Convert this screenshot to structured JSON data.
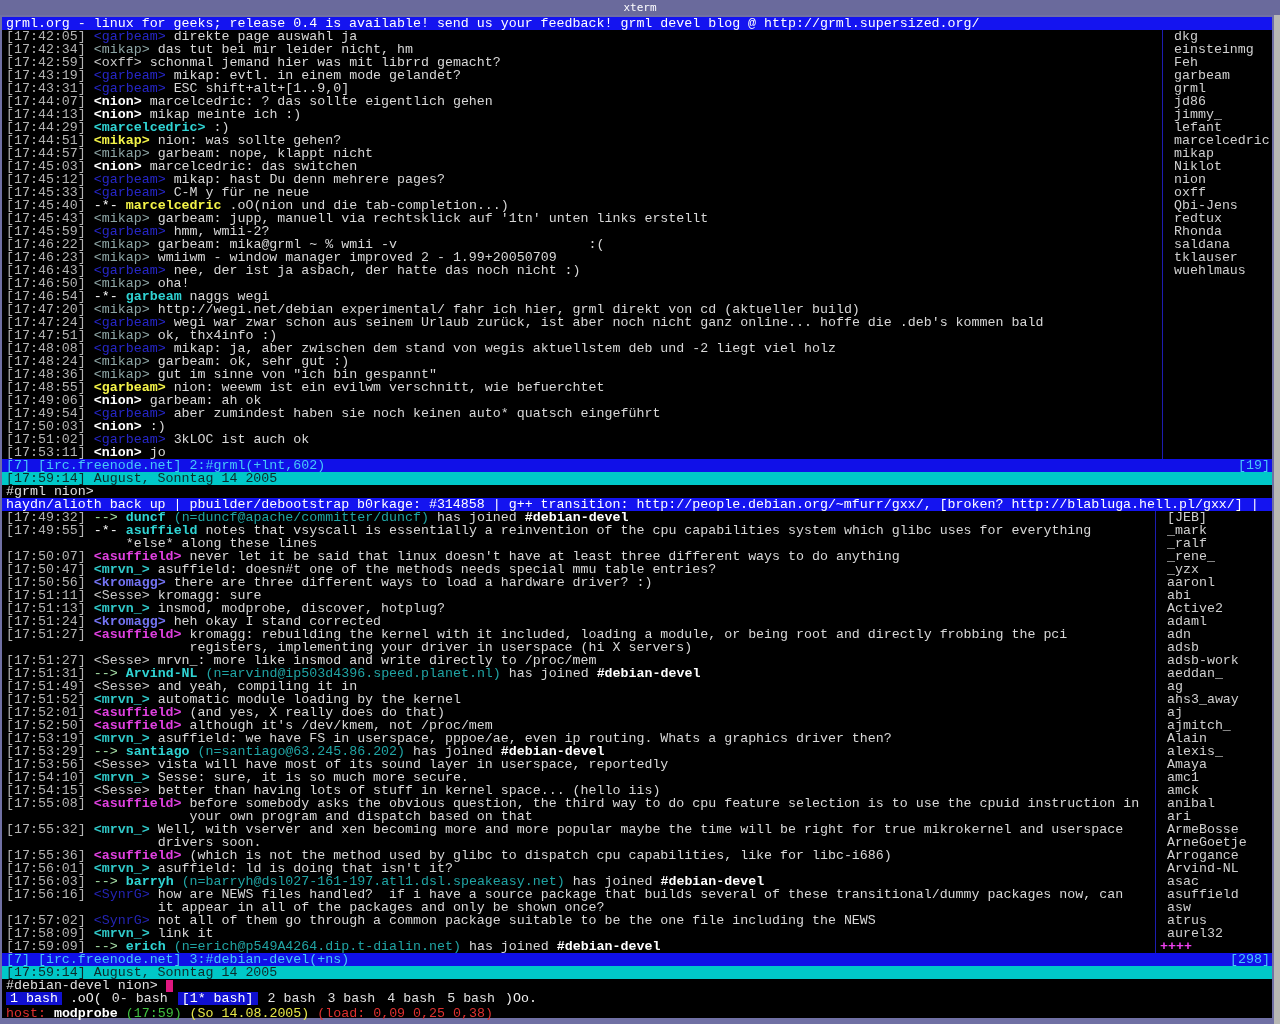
{
  "window": {
    "title": "xterm"
  },
  "panes": [
    {
      "topic": "grml.org - linux for geeks; release 0.4 is available! send us your feedback! grml devel blog @ http://grml.supersized.org/",
      "messages": [
        {
          "kind": "msg",
          "time": "[17:42:05]",
          "nick": "<garbeam>",
          "color": "#2626c8",
          "bold": false,
          "lines": [
            "direkte page auswahl ja"
          ]
        },
        {
          "kind": "msg",
          "time": "[17:42:34]",
          "nick": "<mikap>",
          "color": "#8ea6a6",
          "bold": false,
          "lines": [
            "das tut bei mir leider nicht, hm"
          ]
        },
        {
          "kind": "msg",
          "time": "[17:42:59]",
          "nick": "<oxff>",
          "color": "#c8c8c8",
          "bold": false,
          "lines": [
            "schonmal jemand hier was mit librrd gemacht?"
          ]
        },
        {
          "kind": "msg",
          "time": "[17:43:19]",
          "nick": "<garbeam>",
          "color": "#2626c8",
          "bold": false,
          "lines": [
            "mikap: evtl. in einem mode gelandet?"
          ]
        },
        {
          "kind": "msg",
          "time": "[17:43:31]",
          "nick": "<garbeam>",
          "color": "#2626c8",
          "bold": false,
          "lines": [
            "ESC shift+alt+[1..9,0]"
          ]
        },
        {
          "kind": "msg",
          "time": "[17:44:07]",
          "nick": "<nion>",
          "color": "#ffffff",
          "bold": true,
          "lines": [
            "marcelcedric: ? das sollte eigentlich gehen"
          ]
        },
        {
          "kind": "msg",
          "time": "[17:44:13]",
          "nick": "<nion>",
          "color": "#ffffff",
          "bold": true,
          "lines": [
            "mikap meinte ich :)"
          ]
        },
        {
          "kind": "msg",
          "time": "[17:44:29]",
          "nick": "<marcelcedric>",
          "color": "#30d4d4",
          "bold": true,
          "lines": [
            ":)"
          ]
        },
        {
          "kind": "msg",
          "time": "[17:44:51]",
          "nick": "<mikap>",
          "color": "#f4f448",
          "bold": true,
          "lines": [
            "nion: was sollte gehen?"
          ]
        },
        {
          "kind": "msg",
          "time": "[17:44:57]",
          "nick": "<mikap>",
          "color": "#8ea6a6",
          "bold": false,
          "lines": [
            "garbeam: nope, klappt nicht"
          ]
        },
        {
          "kind": "msg",
          "time": "[17:45:03]",
          "nick": "<nion>",
          "color": "#ffffff",
          "bold": true,
          "lines": [
            "marcelcedric: das switchen"
          ]
        },
        {
          "kind": "msg",
          "time": "[17:45:12]",
          "nick": "<garbeam>",
          "color": "#2626c8",
          "bold": false,
          "lines": [
            "mikap: hast Du denn mehrere pages?"
          ]
        },
        {
          "kind": "msg",
          "time": "[17:45:33]",
          "nick": "<garbeam>",
          "color": "#2626c8",
          "bold": false,
          "lines": [
            "C-M y für ne neue"
          ]
        },
        {
          "kind": "action",
          "time": "[17:45:40]",
          "marker": "-*-",
          "nick": "marcelcedric",
          "color": "#f4f448",
          "bold": true,
          "lines": [
            ".oO(nion und die tab-completion...)"
          ]
        },
        {
          "kind": "msg",
          "time": "[17:45:43]",
          "nick": "<mikap>",
          "color": "#8ea6a6",
          "bold": false,
          "lines": [
            "garbeam: jupp, manuell via rechtsklick auf '1tn' unten links erstellt"
          ]
        },
        {
          "kind": "msg",
          "time": "[17:45:59]",
          "nick": "<garbeam>",
          "color": "#2626c8",
          "bold": false,
          "lines": [
            "hmm, wmii-2?"
          ]
        },
        {
          "kind": "msg",
          "time": "[17:46:22]",
          "nick": "<mikap>",
          "color": "#8ea6a6",
          "bold": false,
          "lines": [
            "garbeam: mika@grml ~ % wmii -v                        :("
          ]
        },
        {
          "kind": "msg",
          "time": "[17:46:23]",
          "nick": "<mikap>",
          "color": "#8ea6a6",
          "bold": false,
          "lines": [
            "wmiiwm - window manager improved 2 - 1.99+20050709"
          ]
        },
        {
          "kind": "msg",
          "time": "[17:46:43]",
          "nick": "<garbeam>",
          "color": "#2626c8",
          "bold": false,
          "lines": [
            "nee, der ist ja asbach, der hatte das noch nicht :)"
          ]
        },
        {
          "kind": "msg",
          "time": "[17:46:50]",
          "nick": "<mikap>",
          "color": "#8ea6a6",
          "bold": false,
          "lines": [
            "oha!"
          ]
        },
        {
          "kind": "action",
          "time": "[17:46:54]",
          "marker": "-*-",
          "nick": "garbeam",
          "color": "#30d4d4",
          "bold": true,
          "lines": [
            "naggs wegi"
          ]
        },
        {
          "kind": "msg",
          "time": "[17:47:20]",
          "nick": "<mikap>",
          "color": "#8ea6a6",
          "bold": false,
          "lines": [
            "http://wegi.net/debian experimental/ fahr ich hier, grml direkt von cd (aktueller build)"
          ]
        },
        {
          "kind": "msg",
          "time": "[17:47:24]",
          "nick": "<garbeam>",
          "color": "#2626c8",
          "bold": false,
          "lines": [
            "wegi war zwar schon aus seinem Urlaub zurück, ist aber noch nicht ganz online... hoffe die .deb's kommen bald"
          ]
        },
        {
          "kind": "msg",
          "time": "[17:47:51]",
          "nick": "<mikap>",
          "color": "#8ea6a6",
          "bold": false,
          "lines": [
            "ok, thx4info :)"
          ]
        },
        {
          "kind": "msg",
          "time": "[17:48:08]",
          "nick": "<garbeam>",
          "color": "#2626c8",
          "bold": false,
          "lines": [
            "mikap: ja, aber zwischen dem stand von wegis aktuellstem deb und -2 liegt viel holz"
          ]
        },
        {
          "kind": "msg",
          "time": "[17:48:24]",
          "nick": "<mikap>",
          "color": "#8ea6a6",
          "bold": false,
          "lines": [
            "garbeam: ok, sehr gut :)"
          ]
        },
        {
          "kind": "msg",
          "time": "[17:48:36]",
          "nick": "<mikap>",
          "color": "#8ea6a6",
          "bold": false,
          "lines": [
            "gut im sinne von \"ich bin gespannt\""
          ]
        },
        {
          "kind": "msg",
          "time": "[17:48:55]",
          "nick": "<garbeam>",
          "color": "#f4f448",
          "bold": true,
          "lines": [
            "nion: weewm ist ein evilwm verschnitt, wie befuerchtet"
          ]
        },
        {
          "kind": "msg",
          "time": "[17:49:06]",
          "nick": "<nion>",
          "color": "#ffffff",
          "bold": true,
          "lines": [
            "garbeam: ah ok"
          ]
        },
        {
          "kind": "msg",
          "time": "[17:49:54]",
          "nick": "<garbeam>",
          "color": "#2626c8",
          "bold": false,
          "lines": [
            "aber zumindest haben sie noch keinen auto* quatsch eingeführt"
          ]
        },
        {
          "kind": "msg",
          "time": "[17:50:03]",
          "nick": "<nion>",
          "color": "#ffffff",
          "bold": true,
          "lines": [
            ":)"
          ]
        },
        {
          "kind": "msg",
          "time": "[17:51:02]",
          "nick": "<garbeam>",
          "color": "#2626c8",
          "bold": false,
          "lines": [
            "3kLOC ist auch ok"
          ]
        },
        {
          "kind": "msg",
          "time": "[17:53:11]",
          "nick": "<nion>",
          "color": "#ffffff",
          "bold": true,
          "lines": [
            "jo"
          ]
        }
      ],
      "nicklist": [
        "dkg",
        "einsteinmg",
        "Feh",
        "garbeam",
        "grml",
        "jd86",
        "jimmy_",
        "lefant",
        "marcelcedric",
        "mikap",
        "Niklot",
        "nion",
        "oxff",
        "Qbi-Jens",
        "redtux",
        "Rhonda",
        "saldana",
        "tklauser",
        "wuehlmaus"
      ],
      "status": {
        "window": "[7] [irc.freenode.net] 2:#grml(+lnt,602)",
        "count": "[19]"
      },
      "clock": "[17:59:14] August, Sonntag 14 2005",
      "prompt": "#grml nion>",
      "cursor": false
    },
    {
      "topic": "haydn/alioth back up | pbuilder/debootstrap b0rkage: #314858 | g++ transition: http://people.debian.org/~mfurr/gxx/, [broken? http://blabluga.hell.pl/gxx/] |",
      "messages": [
        {
          "kind": "join",
          "time": "[17:49:32]",
          "marker": "-->",
          "nick": "duncf",
          "host": "(n=duncf@apache/committer/duncf)",
          "text": "has joined",
          "channel": "#debian-devel"
        },
        {
          "kind": "action",
          "time": "[17:49:55]",
          "marker": "-*-",
          "nick": "asuffield",
          "color": "#30d4d4",
          "bold": true,
          "lines": [
            "notes that vsyscall is essentially a reinvention of the cpu capabilities system which glibc uses for everything",
            "*else* along these lines"
          ]
        },
        {
          "kind": "msg",
          "time": "[17:50:07]",
          "nick": "<asuffield>",
          "color": "#e040e0",
          "bold": true,
          "lines": [
            "never let it be said that linux doesn't have at least three different ways to do anything"
          ]
        },
        {
          "kind": "msg",
          "time": "[17:50:47]",
          "nick": "<mrvn_>",
          "color": "#30c8c8",
          "bold": true,
          "lines": [
            "asuffield: doesn#t one of the methods needs special mmu table entries?"
          ]
        },
        {
          "kind": "msg",
          "time": "[17:50:56]",
          "nick": "<kromagg>",
          "color": "#7474f4",
          "bold": true,
          "lines": [
            "there are three different ways to load a hardware driver? :)"
          ]
        },
        {
          "kind": "msg",
          "time": "[17:51:11]",
          "nick": "<Sesse>",
          "color": "#c8c8c8",
          "bold": false,
          "lines": [
            "kromagg: sure"
          ]
        },
        {
          "kind": "msg",
          "time": "[17:51:13]",
          "nick": "<mrvn_>",
          "color": "#30c8c8",
          "bold": true,
          "lines": [
            "insmod, modprobe, discover, hotplug?"
          ]
        },
        {
          "kind": "msg",
          "time": "[17:51:24]",
          "nick": "<kromagg>",
          "color": "#7474f4",
          "bold": true,
          "lines": [
            "heh okay I stand corrected"
          ]
        },
        {
          "kind": "msg",
          "time": "[17:51:27]",
          "nick": "<asuffield>",
          "color": "#e040e0",
          "bold": true,
          "lines": [
            "kromagg: rebuilding the kernel with it included, loading a module, or being root and directly frobbing the pci",
            "registers, implementing your driver in userspace (hi X servers)"
          ]
        },
        {
          "kind": "msg",
          "time": "[17:51:27]",
          "nick": "<Sesse>",
          "color": "#c8c8c8",
          "bold": false,
          "lines": [
            "mrvn_: more like insmod and write directly to /proc/mem"
          ]
        },
        {
          "kind": "join",
          "time": "[17:51:31]",
          "marker": "-->",
          "nick": "Arvind-NL",
          "host": "(n=arvind@ip503d4396.speed.planet.nl)",
          "text": "has joined",
          "channel": "#debian-devel"
        },
        {
          "kind": "msg",
          "time": "[17:51:49]",
          "nick": "<Sesse>",
          "color": "#c8c8c8",
          "bold": false,
          "lines": [
            "and yeah, compiling it in"
          ]
        },
        {
          "kind": "msg",
          "time": "[17:51:52]",
          "nick": "<mrvn_>",
          "color": "#30c8c8",
          "bold": true,
          "lines": [
            "automatic module loading by the kernel"
          ]
        },
        {
          "kind": "msg",
          "time": "[17:52:01]",
          "nick": "<asuffield>",
          "color": "#e040e0",
          "bold": true,
          "lines": [
            "(and yes, X really does do that)"
          ]
        },
        {
          "kind": "msg",
          "time": "[17:52:50]",
          "nick": "<asuffield>",
          "color": "#e040e0",
          "bold": true,
          "lines": [
            "although it's /dev/kmem, not /proc/mem"
          ]
        },
        {
          "kind": "msg",
          "time": "[17:53:19]",
          "nick": "<mrvn_>",
          "color": "#30c8c8",
          "bold": true,
          "lines": [
            "asuffield: we have FS in userspace, pppoe/ae, even ip routing. Whats a graphics driver then?"
          ]
        },
        {
          "kind": "join",
          "time": "[17:53:29]",
          "marker": "-->",
          "nick": "santiago",
          "host": "(n=santiago@63.245.86.202)",
          "text": "has joined",
          "channel": "#debian-devel"
        },
        {
          "kind": "msg",
          "time": "[17:53:56]",
          "nick": "<Sesse>",
          "color": "#c8c8c8",
          "bold": false,
          "lines": [
            "vista will have most of its sound layer in userspace, reportedly"
          ]
        },
        {
          "kind": "msg",
          "time": "[17:54:10]",
          "nick": "<mrvn_>",
          "color": "#30c8c8",
          "bold": true,
          "lines": [
            "Sesse: sure, it is so much more secure."
          ]
        },
        {
          "kind": "msg",
          "time": "[17:54:15]",
          "nick": "<Sesse>",
          "color": "#c8c8c8",
          "bold": false,
          "lines": [
            "better than having lots of stuff in kernel space... (hello iis)"
          ]
        },
        {
          "kind": "msg",
          "time": "[17:55:08]",
          "nick": "<asuffield>",
          "color": "#e040e0",
          "bold": true,
          "lines": [
            "before somebody asks the obvious question, the third way to do cpu feature selection is to use the cpuid instruction in",
            "your own program and dispatch based on that"
          ]
        },
        {
          "kind": "msg",
          "time": "[17:55:32]",
          "nick": "<mrvn_>",
          "color": "#30c8c8",
          "bold": true,
          "lines": [
            "Well, with vserver and xen becoming more and more popular maybe the time will be right for true mikrokernel and userspace",
            "drivers soon."
          ]
        },
        {
          "kind": "msg",
          "time": "[17:55:36]",
          "nick": "<asuffield>",
          "color": "#e040e0",
          "bold": true,
          "lines": [
            "(which is not the method used by glibc to dispatch cpu capabilities, like for libc-i686)"
          ]
        },
        {
          "kind": "msg",
          "time": "[17:56:01]",
          "nick": "<mrvn_>",
          "color": "#30c8c8",
          "bold": true,
          "lines": [
            "asuffield: ld is doing that isn't it?"
          ]
        },
        {
          "kind": "join",
          "time": "[17:56:03]",
          "marker": "-->",
          "nick": "barryh",
          "host": "(n=barryh@dsl027-161-197.atl1.dsl.speakeasy.net)",
          "text": "has joined",
          "channel": "#debian-devel"
        },
        {
          "kind": "msg",
          "time": "[17:56:16]",
          "nick": "<SynrG>",
          "color": "#2424b4",
          "bold": false,
          "lines": [
            "how are NEWS files handled?  if i have a source package that builds several of these transitional/dummy packages now, can",
            "it appear in all of the packages and only be shown once?"
          ]
        },
        {
          "kind": "msg",
          "time": "[17:57:02]",
          "nick": "<SynrG>",
          "color": "#2424b4",
          "bold": false,
          "lines": [
            "not all of them go through a common package suitable to be the one file including the NEWS"
          ]
        },
        {
          "kind": "msg",
          "time": "[17:58:09]",
          "nick": "<mrvn_>",
          "color": "#30c8c8",
          "bold": true,
          "lines": [
            "link it"
          ]
        },
        {
          "kind": "join",
          "time": "[17:59:09]",
          "marker": "-->",
          "nick": "erich",
          "host": "(n=erich@p549A4264.dip.t-dialin.net)",
          "text": "has joined",
          "channel": "#debian-devel"
        }
      ],
      "nicklist": [
        "[JEB]",
        "_mark",
        "_ralf",
        "_rene_",
        "_yzx",
        "aaronl",
        "abi",
        "Active2",
        "adaml",
        "adn",
        "adsb",
        "adsb-work",
        "aeddan_",
        "ag",
        "ahs3_away",
        "aj",
        "ajmitch_",
        "Alain",
        "alexis_",
        "Amaya",
        "amc1",
        "amck",
        "anibal",
        "ari",
        "ArmeBosse",
        "ArneGoetje",
        "Arrogance",
        "Arvind-NL",
        "asac",
        "asuffield",
        "asw",
        "atrus",
        "aurel32"
      ],
      "more": "++++",
      "status": {
        "window": "[7] [irc.freenode.net] 3:#debian-devel(+ns)",
        "count": "[298]"
      },
      "clock": "[17:59:14] August, Sonntag 14 2005",
      "prompt": "#debian-devel nion>",
      "cursor": true
    }
  ],
  "screen_bar": [
    {
      "kind": "window",
      "label": "1 bash",
      "selected": true
    },
    {
      "kind": "deco",
      "label": ".oO(",
      "selected": false
    },
    {
      "kind": "window",
      "label": "0- bash",
      "selected": false
    },
    {
      "kind": "window",
      "label": "[1* bash]",
      "selected": true
    },
    {
      "kind": "window",
      "label": "2 bash",
      "selected": false
    },
    {
      "kind": "window",
      "label": "3 bash",
      "selected": false
    },
    {
      "kind": "window",
      "label": "4 bash",
      "selected": false
    },
    {
      "kind": "window",
      "label": "5 bash",
      "selected": false
    },
    {
      "kind": "deco",
      "label": ")Oo.",
      "selected": false
    }
  ],
  "hardstatus": [
    {
      "text": "host:",
      "color": "#e03030",
      "bold": false
    },
    {
      "text": "modprobe",
      "color": "#ffffff",
      "bold": true
    },
    {
      "text": "(17:59)",
      "color": "#40c040",
      "bold": false
    },
    {
      "text": "(So 14.08.2005)",
      "color": "#e8e848",
      "bold": false
    },
    {
      "text": "(load: 0,09 0,25 0,38)",
      "color": "#e03030",
      "bold": false
    }
  ]
}
